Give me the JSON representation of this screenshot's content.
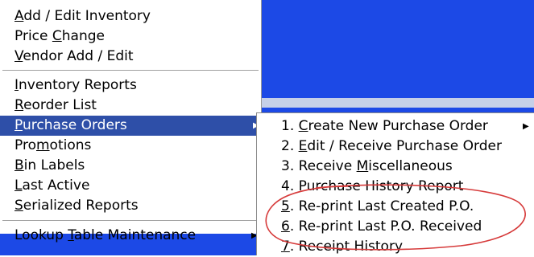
{
  "colors": {
    "desktop": "#1c49e6",
    "highlight": "#2e4fa8",
    "menu_bg": "#ffffff",
    "annotation": "#d63a3a"
  },
  "main_menu": {
    "items": [
      {
        "pre": "",
        "u": "A",
        "post": "dd / Edit Inventory"
      },
      {
        "pre": "Price ",
        "u": "C",
        "post": "hange"
      },
      {
        "pre": "",
        "u": "V",
        "post": "endor Add / Edit"
      },
      {
        "pre": "",
        "u": "I",
        "post": "nventory Reports"
      },
      {
        "pre": "",
        "u": "R",
        "post": "eorder List"
      },
      {
        "pre": "",
        "u": "P",
        "post": "urchase Orders"
      },
      {
        "pre": "Pro",
        "u": "m",
        "post": "otions"
      },
      {
        "pre": "",
        "u": "B",
        "post": "in Labels"
      },
      {
        "pre": "",
        "u": "L",
        "post": "ast Active"
      },
      {
        "pre": "",
        "u": "S",
        "post": "erialized Reports"
      },
      {
        "pre": "Lookup ",
        "u": "T",
        "post": "able Maintenance"
      }
    ]
  },
  "submenu": {
    "items": [
      {
        "pre": "1. ",
        "u": "C",
        "post": "reate New Purchase Order"
      },
      {
        "pre": "2. ",
        "u": "E",
        "post": "dit / Receive Purchase Order"
      },
      {
        "pre": "3. Receive ",
        "u": "M",
        "post": "iscellaneous"
      },
      {
        "pre": "4. Purchase History Report",
        "u": "",
        "post": ""
      },
      {
        "pre": "",
        "u": "5",
        "post": ". Re-print Last Created P.O."
      },
      {
        "pre": "",
        "u": "6",
        "post": ". Re-print Last P.O. Received"
      },
      {
        "pre": "",
        "u": "7",
        "post": ". Receipt History"
      }
    ]
  }
}
